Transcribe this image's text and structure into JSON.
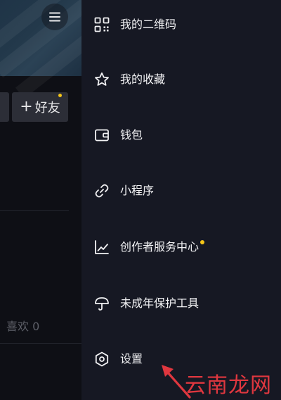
{
  "profile": {
    "add_friend_label": "好友",
    "add_friend_plus": "+",
    "likes_label": "喜欢 0"
  },
  "drawer": {
    "items": [
      {
        "label": "我的二维码",
        "icon": "qr-code-icon"
      },
      {
        "label": "我的收藏",
        "icon": "star-icon"
      },
      {
        "label": "钱包",
        "icon": "wallet-icon"
      },
      {
        "label": "小程序",
        "icon": "link-icon"
      },
      {
        "label": "创作者服务中心",
        "icon": "trend-chart-icon",
        "has_badge": true
      },
      {
        "label": "未成年保护工具",
        "icon": "umbrella-icon"
      },
      {
        "label": "设置",
        "icon": "settings-hexagon-icon"
      }
    ]
  },
  "watermark": {
    "text": "云南龙网"
  },
  "colors": {
    "drawer_bg": "#161823",
    "page_bg": "#0e0f15",
    "badge": "#f5c518",
    "watermark": "#e0373f"
  }
}
